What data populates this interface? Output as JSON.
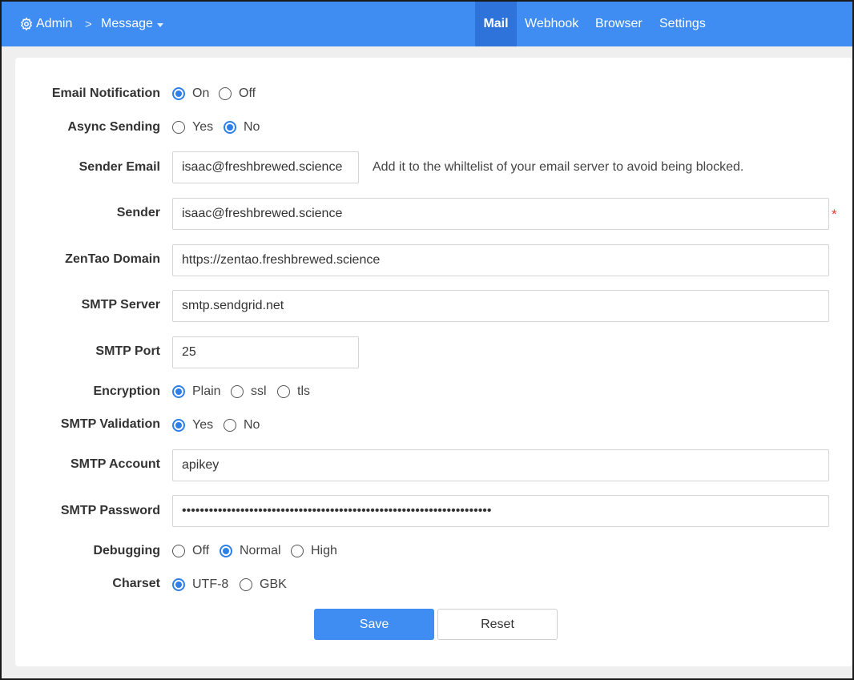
{
  "nav": {
    "admin_label": "Admin",
    "admin_icon": "gear-icon",
    "separator": ">",
    "message_label": "Message",
    "tabs": [
      {
        "label": "Mail",
        "active": true
      },
      {
        "label": "Webhook",
        "active": false
      },
      {
        "label": "Browser",
        "active": false
      },
      {
        "label": "Settings",
        "active": false
      }
    ]
  },
  "form": {
    "email_notification": {
      "label": "Email Notification",
      "options": [
        "On",
        "Off"
      ],
      "selected": "On"
    },
    "async_sending": {
      "label": "Async Sending",
      "options": [
        "Yes",
        "No"
      ],
      "selected": "No"
    },
    "sender_email": {
      "label": "Sender Email",
      "value": "isaac@freshbrewed.science",
      "hint": "Add it to the whiltelist of your email server to avoid being blocked."
    },
    "sender": {
      "label": "Sender",
      "value": "isaac@freshbrewed.science",
      "required_mark": "*"
    },
    "zentao_domain": {
      "label": "ZenTao Domain",
      "value": "https://zentao.freshbrewed.science"
    },
    "smtp_server": {
      "label": "SMTP Server",
      "value": "smtp.sendgrid.net"
    },
    "smtp_port": {
      "label": "SMTP Port",
      "value": "25"
    },
    "encryption": {
      "label": "Encryption",
      "options": [
        "Plain",
        "ssl",
        "tls"
      ],
      "selected": "Plain"
    },
    "smtp_validation": {
      "label": "SMTP Validation",
      "options": [
        "Yes",
        "No"
      ],
      "selected": "Yes"
    },
    "smtp_account": {
      "label": "SMTP Account",
      "value": "apikey"
    },
    "smtp_password": {
      "label": "SMTP Password",
      "value": "•••••••••••••••••••••••••••••••••••••••••••••••••••••••••••••••••••••"
    },
    "debugging": {
      "label": "Debugging",
      "options": [
        "Off",
        "Normal",
        "High"
      ],
      "selected": "Normal"
    },
    "charset": {
      "label": "Charset",
      "options": [
        "UTF-8",
        "GBK"
      ],
      "selected": "UTF-8"
    }
  },
  "buttons": {
    "save": "Save",
    "reset": "Reset"
  },
  "colors": {
    "primary": "#3f8cf2",
    "active_tab": "#2e73d9",
    "required": "#e53935"
  }
}
